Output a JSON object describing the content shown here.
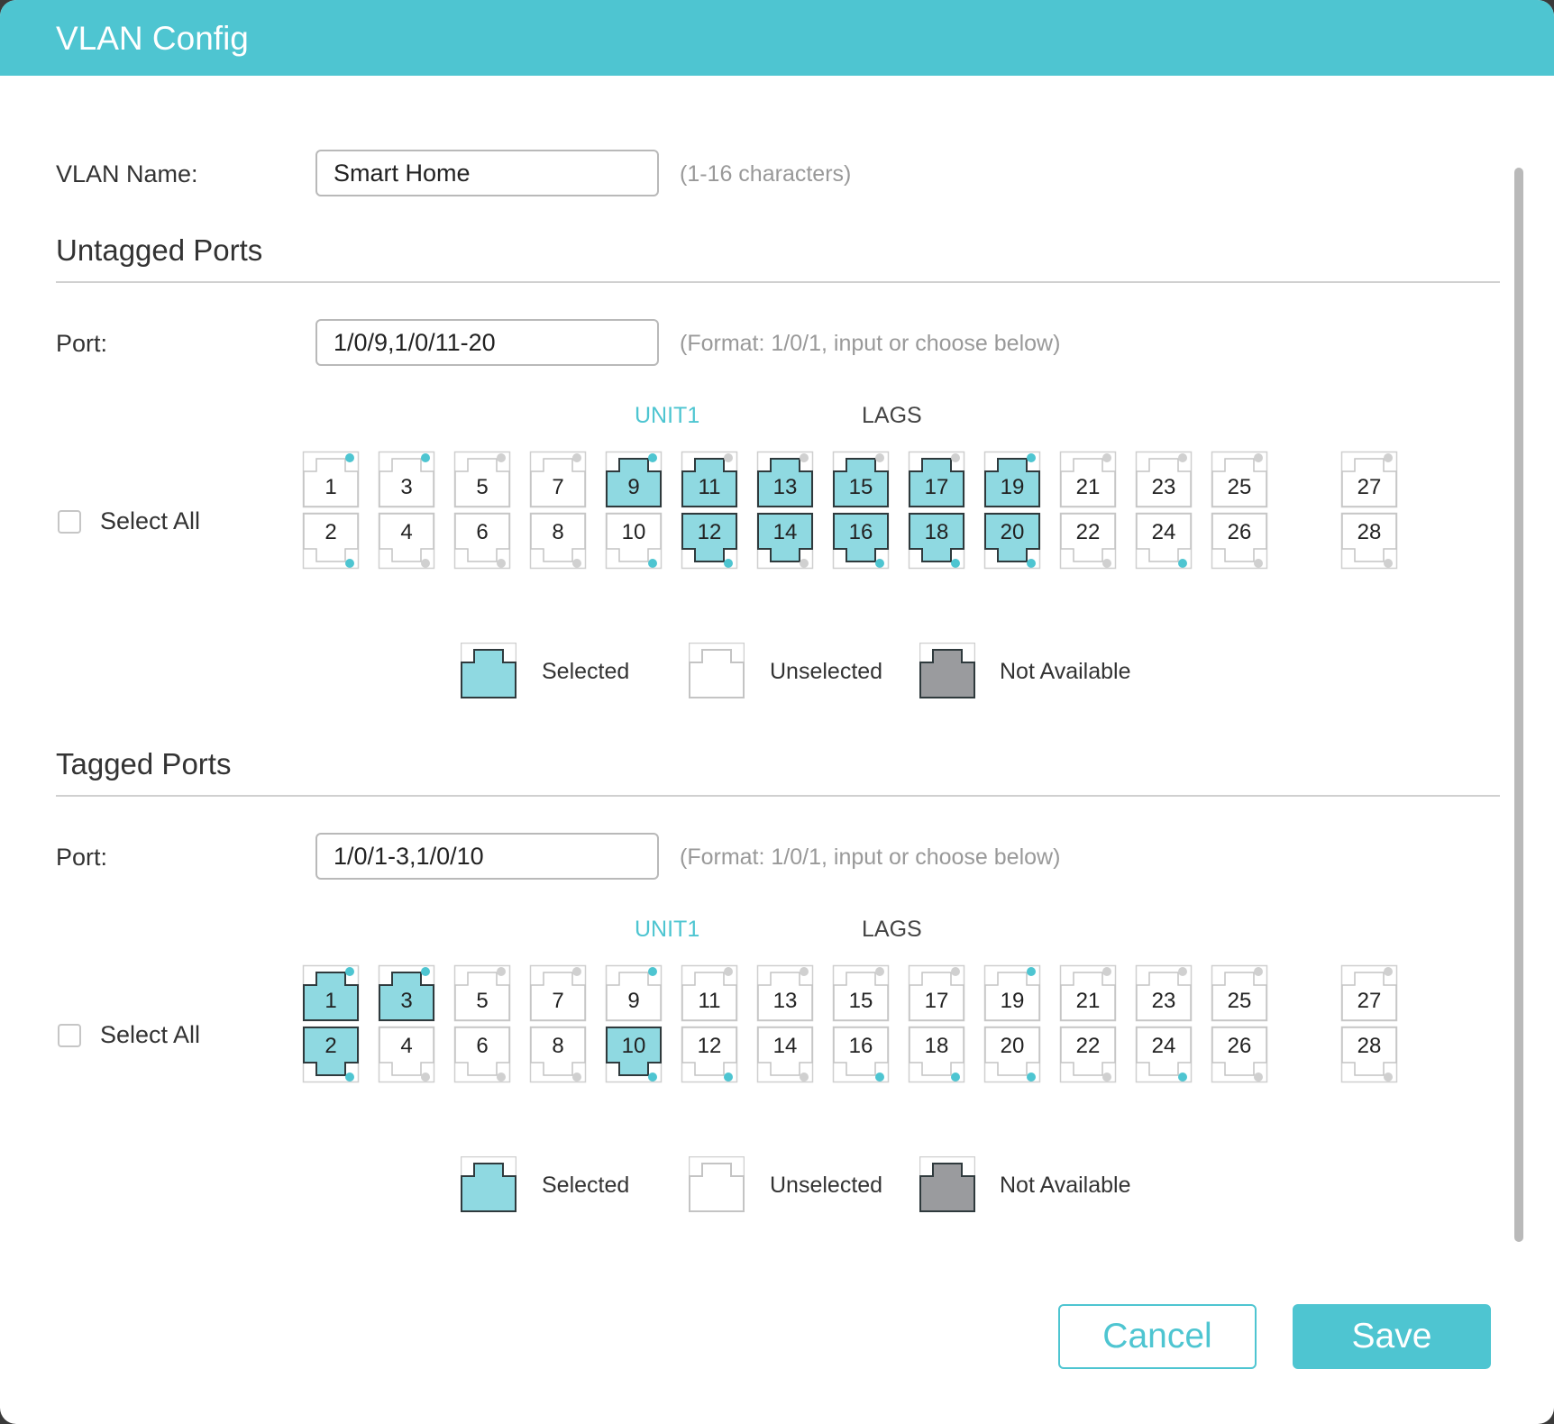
{
  "dialog": {
    "title": "VLAN Config",
    "vlan_name_label": "VLAN Name:",
    "vlan_name_value": "Smart Home",
    "vlan_name_hint": "(1-16 characters)",
    "cancel_label": "Cancel",
    "save_label": "Save"
  },
  "colors": {
    "accent": "#4ec5d1",
    "selected_fill": "#8fd9e1",
    "unavailable_fill": "#9a9b9e",
    "link_up_dot": "#4ec5d1",
    "link_down_dot": "#d0d0d0"
  },
  "legend": {
    "selected": "Selected",
    "unselected": "Unselected",
    "not_available": "Not Available"
  },
  "untagged": {
    "title": "Untagged Ports",
    "port_label": "Port:",
    "port_value": "1/0/9,1/0/11-20",
    "port_hint": "(Format: 1/0/1, input or choose below)",
    "unit_label": "UNIT1",
    "lags_label": "LAGS",
    "select_all_label": "Select All",
    "selected_ports": [
      9,
      11,
      12,
      13,
      14,
      15,
      16,
      17,
      18,
      19,
      20
    ]
  },
  "tagged": {
    "title": "Tagged Ports",
    "port_label": "Port:",
    "port_value": "1/0/1-3,1/0/10",
    "port_hint": "(Format: 1/0/1, input or choose below)",
    "unit_label": "UNIT1",
    "lags_label": "LAGS",
    "select_all_label": "Select All",
    "selected_ports": [
      1,
      2,
      3,
      10
    ]
  },
  "link_up_ports": [
    1,
    2,
    3,
    9,
    10,
    12,
    16,
    18,
    19,
    20,
    24
  ],
  "port_numbers": [
    1,
    2,
    3,
    4,
    5,
    6,
    7,
    8,
    9,
    10,
    11,
    12,
    13,
    14,
    15,
    16,
    17,
    18,
    19,
    20,
    21,
    22,
    23,
    24,
    25,
    26,
    27,
    28
  ]
}
